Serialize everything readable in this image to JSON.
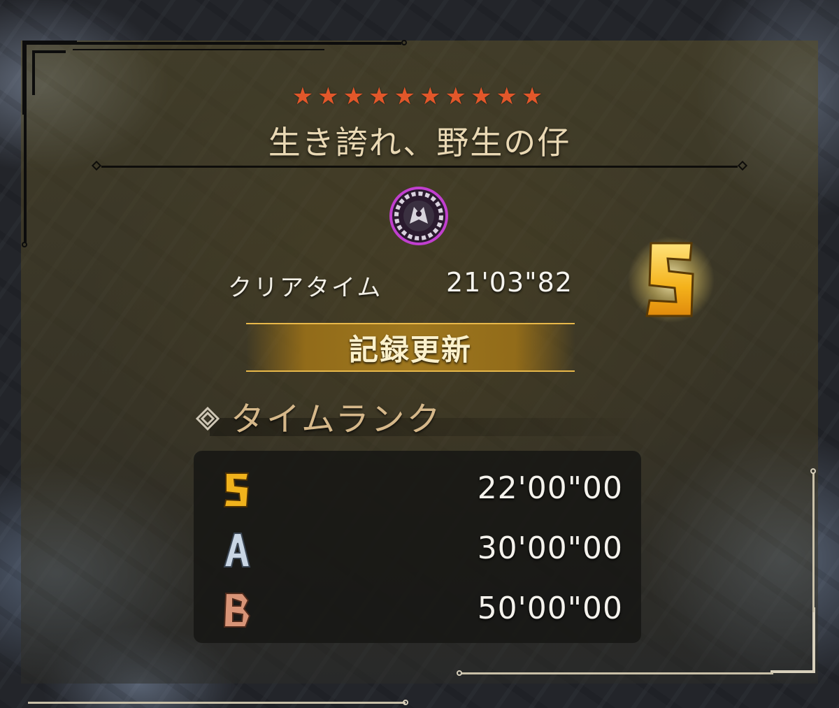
{
  "quest": {
    "stars": "★★★★★★★★★★",
    "star_color": "#e2572a",
    "title": "生き誇れ、野生の仔",
    "icon": "monster-crest-icon"
  },
  "result": {
    "clear_label": "クリアタイム",
    "clear_time": "21'03\"82",
    "achieved_rank": "S",
    "record_label": "記録更新"
  },
  "time_rank": {
    "heading": "タイムランク",
    "rows": [
      {
        "rank": "S",
        "time": "22'00\"00",
        "color": "#f0b21c"
      },
      {
        "rank": "A",
        "time": "30'00\"00",
        "color": "#c9d6e4"
      },
      {
        "rank": "B",
        "time": "50'00\"00",
        "color": "#d89477"
      }
    ]
  }
}
